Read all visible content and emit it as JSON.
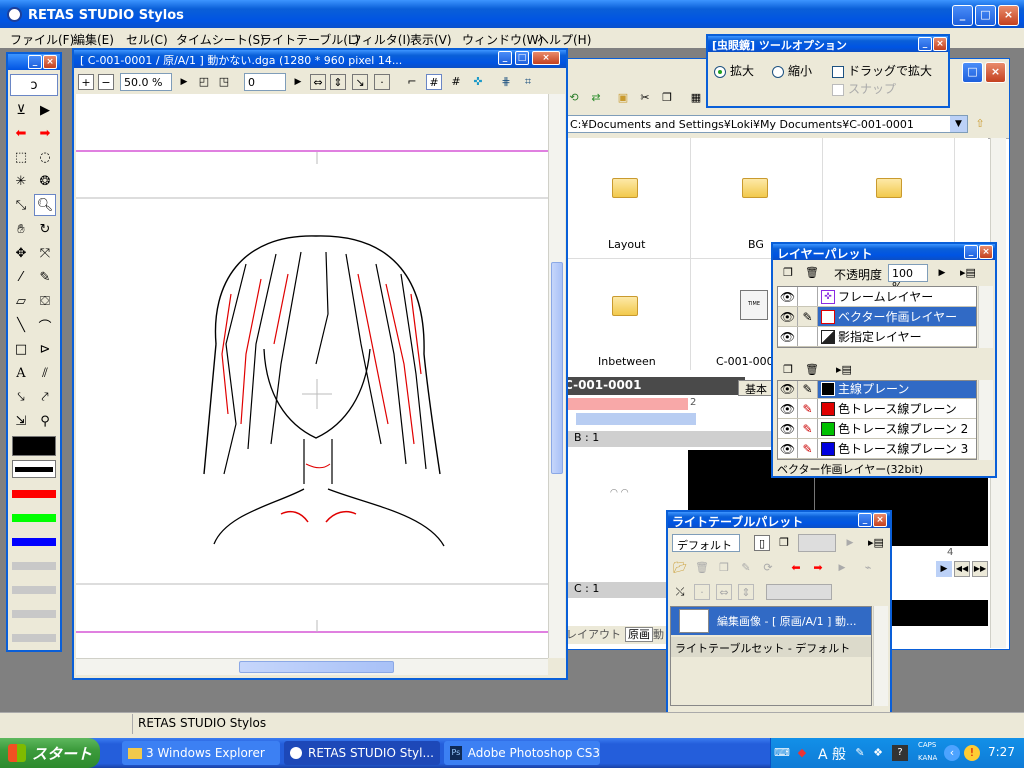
{
  "app": {
    "title": "RETAS STUDIO Stylos",
    "status": "RETAS STUDIO Stylos"
  },
  "menu": [
    {
      "label": "ファイル(F)"
    },
    {
      "label": "編集(E)"
    },
    {
      "label": "セル(C)"
    },
    {
      "label": "タイムシート(S)"
    },
    {
      "label": "ライトテーブル(L)"
    },
    {
      "label": "フィルタ(I)"
    },
    {
      "label": "表示(V)"
    },
    {
      "label": "ウィンドウ(W)"
    },
    {
      "label": "ヘルプ(H)"
    }
  ],
  "canvas_window": {
    "title": "[ C-001-0001 / 原/A/1 ] 動かない.dga (1280 * 960 pixel 14...",
    "zoom": "50.0 %",
    "rotation": "0"
  },
  "explorer": {
    "path": "C:¥Documents and Settings¥Loki¥My Documents¥C-001-0001",
    "items": [
      {
        "label": "Layout"
      },
      {
        "label": "BG"
      },
      {
        "label": "Inbetween"
      },
      {
        "label": "C-001-000"
      }
    ]
  },
  "timesheet": {
    "title": "C-001-0001",
    "tab": "基本",
    "layer_b": "B : 1",
    "layer_c": "C : 1",
    "frame_2": "2",
    "frame_4": "4",
    "bottom_tabs": [
      "レイアウト",
      "原画",
      "動"
    ]
  },
  "tool_options": {
    "title": "[虫眼鏡] ツールオプション",
    "zoom_in": "拡大",
    "zoom_out": "縮小",
    "drag_zoom": "ドラッグで拡大",
    "snap": "スナップ"
  },
  "layer_palette": {
    "title": "レイヤーパレット",
    "opacity_label": "不透明度",
    "opacity_value": "100 %",
    "layers": [
      {
        "name": "フレームレイヤー"
      },
      {
        "name": "ベクター作画レイヤー"
      },
      {
        "name": "影指定レイヤー"
      }
    ],
    "planes": [
      {
        "name": "主線プレーン",
        "color": "#000000"
      },
      {
        "name": "色トレース線プレーン",
        "color": "#e00000"
      },
      {
        "name": "色トレース線プレーン 2",
        "color": "#00c000"
      },
      {
        "name": "色トレース線プレーン 3",
        "color": "#0000e0"
      }
    ],
    "status": "ベクター作画レイヤー(32bit)"
  },
  "lighttable": {
    "title": "ライトテーブルパレット",
    "preset": "デフォルト",
    "entry": "編集画像 - [ 原画/A/1 ] 動...",
    "set": "ライトテーブルセット - デフォルト"
  },
  "taskbar": {
    "start": "スタート",
    "tasks": [
      {
        "label": "3 Windows Explorer"
      },
      {
        "label": "RETAS STUDIO Styl..."
      },
      {
        "label": "Adobe Photoshop CS3"
      }
    ],
    "ime": "A 般",
    "caps": "CAPS",
    "kana": "KANA",
    "clock": "7:27"
  },
  "colors": {
    "accent": "#0054e3",
    "taskbar": "#245edb",
    "start": "#3c9b3c",
    "pen_red": "#ff0000",
    "pen_green": "#00ff00",
    "pen_blue": "#0000ff"
  }
}
